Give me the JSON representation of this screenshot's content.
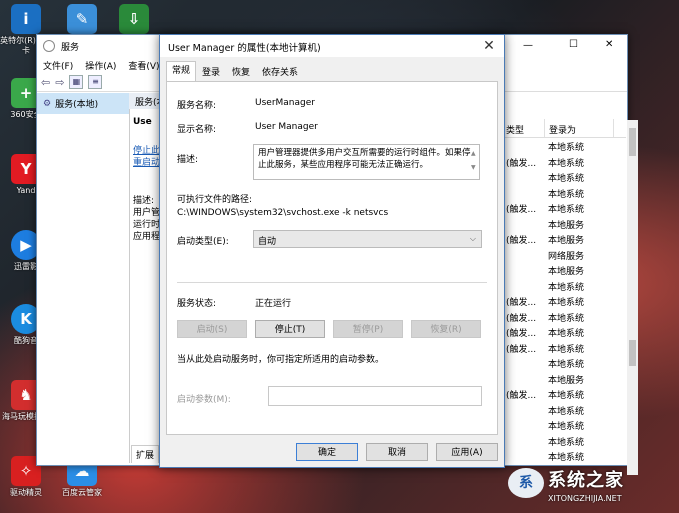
{
  "desktop": {
    "icons": [
      {
        "label": "英特尔(R)芯显卡",
        "icon": "intel-icon",
        "color": "#1b6fc2"
      },
      {
        "label": "",
        "icon": "notepad-icon",
        "color": "#3b8fd8"
      },
      {
        "label": "",
        "icon": "download-icon",
        "color": "#2a8a3a"
      },
      {
        "label": "360安全",
        "icon": "360-icon",
        "color": "#3aa84a"
      },
      {
        "label": "Yand",
        "icon": "yandex-icon",
        "color": "#e21b23"
      },
      {
        "label": "迅雷影",
        "icon": "xunlei-icon",
        "color": "#1d7de0"
      },
      {
        "label": "酷狗音",
        "icon": "kugou-icon",
        "color": "#1b8ce0"
      },
      {
        "label": "海马玩模拟器",
        "icon": "haima-icon",
        "color": "#d22e2e"
      },
      {
        "label": "驱动精灵",
        "icon": "driver-icon",
        "color": "#d82020"
      },
      {
        "label": "百度云管家",
        "icon": "baiduyun-icon",
        "color": "#2b8ee6"
      }
    ]
  },
  "services_window": {
    "title": "服务",
    "controls": {
      "minimize": "—",
      "maximize": "☐",
      "close": "✕"
    },
    "menu": [
      "文件(F)",
      "操作(A)",
      "查看(V)"
    ],
    "tree_item": "服务(本地)",
    "panel_header": "服务(本地)",
    "panel_title": "Use",
    "links": [
      "停止此",
      "重启动"
    ],
    "desc_fragment": [
      "描述:",
      "用户管",
      "运行时",
      "应用程"
    ],
    "tab_fragment": "扩展",
    "columns": [
      "类型",
      "登录为"
    ],
    "rows": [
      {
        "type": "",
        "logon": "本地系统"
      },
      {
        "type": "(触发...",
        "logon": "本地系统"
      },
      {
        "type": "",
        "logon": "本地系统"
      },
      {
        "type": "",
        "logon": "本地系统"
      },
      {
        "type": "(触发...",
        "logon": "本地系统"
      },
      {
        "type": "",
        "logon": "本地服务"
      },
      {
        "type": "(触发...",
        "logon": "本地服务"
      },
      {
        "type": "",
        "logon": "网络服务"
      },
      {
        "type": "",
        "logon": "本地服务"
      },
      {
        "type": "",
        "logon": "本地系统"
      },
      {
        "type": "(触发...",
        "logon": "本地系统"
      },
      {
        "type": "(触发...",
        "logon": "本地系统"
      },
      {
        "type": "(触发...",
        "logon": "本地系统"
      },
      {
        "type": "(触发...",
        "logon": "本地系统"
      },
      {
        "type": "",
        "logon": "本地系统"
      },
      {
        "type": "",
        "logon": "本地服务"
      },
      {
        "type": "(触发...",
        "logon": "本地系统"
      },
      {
        "type": "",
        "logon": "本地系统"
      },
      {
        "type": "",
        "logon": "本地系统"
      },
      {
        "type": "",
        "logon": "本地系统"
      },
      {
        "type": "",
        "logon": "本地系统"
      }
    ]
  },
  "dialog": {
    "title": "User Manager 的属性(本地计算机)",
    "close": "✕",
    "tabs": [
      "常规",
      "登录",
      "恢复",
      "依存关系"
    ],
    "service_name_label": "服务名称:",
    "service_name": "UserManager",
    "display_name_label": "显示名称:",
    "display_name": "User Manager",
    "description_label": "描述:",
    "description": "用户管理器提供多用户交互所需要的运行时组件。如果停止此服务，某些应用程序可能无法正确运行。",
    "path_label": "可执行文件的路径:",
    "path": "C:\\WINDOWS\\system32\\svchost.exe -k netsvcs",
    "startup_label": "启动类型(E):",
    "startup_value": "自动",
    "status_label": "服务状态:",
    "status_value": "正在运行",
    "buttons": {
      "start": "启动(S)",
      "stop": "停止(T)",
      "pause": "暂停(P)",
      "resume": "恢复(R)"
    },
    "hint": "当从此处启动服务时，你可指定所适用的启动参数。",
    "params_label": "启动参数(M):",
    "params_value": "",
    "footer": {
      "ok": "确定",
      "cancel": "取消",
      "apply": "应用(A)"
    }
  },
  "watermark": {
    "title": "系统之家",
    "url": "XITONGZHIJIA.NET",
    "logo": "系"
  }
}
